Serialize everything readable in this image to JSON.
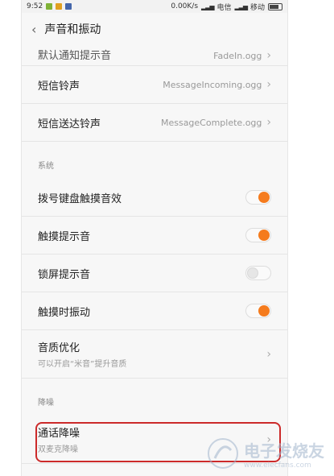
{
  "status_bar": {
    "time": "9:52",
    "speed": "0.00K/s",
    "carrier1": "电信",
    "carrier2": "移动"
  },
  "header": {
    "back_icon": "chevron-left-icon",
    "title": "声音和振动"
  },
  "rows_top": [
    {
      "label": "默认通知提示音",
      "value": "FadeIn.ogg"
    },
    {
      "label": "短信铃声",
      "value": "MessageIncoming.ogg"
    },
    {
      "label": "短信送达铃声",
      "value": "MessageComplete.ogg"
    }
  ],
  "section_system": "系统",
  "system_toggles": [
    {
      "label": "拨号键盘触摸音效",
      "on": true
    },
    {
      "label": "触摸提示音",
      "on": true
    },
    {
      "label": "锁屏提示音",
      "on": false
    },
    {
      "label": "触摸时振动",
      "on": true
    }
  ],
  "audio_quality": {
    "label": "音质优化",
    "sub": "可以开启“米音”提升音质"
  },
  "section_noise": "降噪",
  "noise_reduction": {
    "label": "通话降噪",
    "sub": "双麦克降噪"
  },
  "watermark": {
    "cn": "电子发烧友",
    "url": "www.elecfans.com"
  },
  "colors": {
    "toggle_on": "#f57b1d",
    "highlight": "#cc2a2a"
  }
}
